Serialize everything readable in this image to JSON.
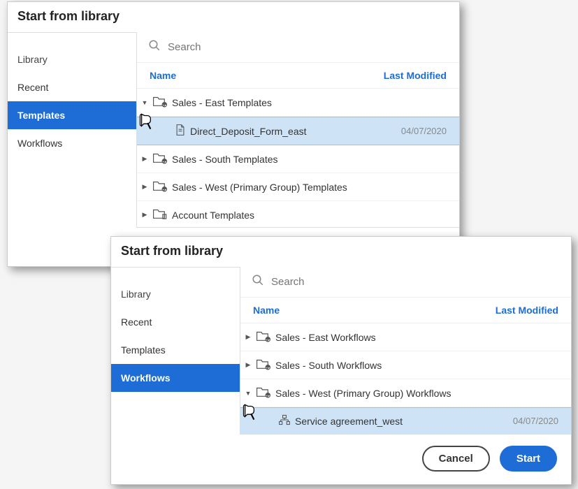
{
  "dialog1": {
    "title": "Start from library",
    "sidebar": {
      "heading": "Library",
      "items": [
        {
          "label": "Recent"
        },
        {
          "label": "Templates"
        },
        {
          "label": "Workflows"
        }
      ],
      "activeIndex": 1
    },
    "search": {
      "placeholder": "Search"
    },
    "columns": {
      "name": "Name",
      "modified": "Last Modified"
    },
    "tree": [
      {
        "label": "Sales - East Templates",
        "expanded": true,
        "iconType": "group"
      },
      {
        "label": "Direct_Deposit_Form_east",
        "date": "04/07/2020",
        "child": true,
        "selected": true,
        "iconType": "file"
      },
      {
        "label": "Sales - South Templates",
        "expanded": false,
        "iconType": "group"
      },
      {
        "label": "Sales - West (Primary Group) Templates",
        "expanded": false,
        "iconType": "group"
      },
      {
        "label": "Account Templates",
        "expanded": false,
        "iconType": "account"
      }
    ]
  },
  "dialog2": {
    "title": "Start from library",
    "sidebar": {
      "heading": "Library",
      "items": [
        {
          "label": "Recent"
        },
        {
          "label": "Templates"
        },
        {
          "label": "Workflows"
        }
      ],
      "activeIndex": 2
    },
    "search": {
      "placeholder": "Search"
    },
    "columns": {
      "name": "Name",
      "modified": "Last Modified"
    },
    "tree": [
      {
        "label": "Sales - East Workflows",
        "expanded": false,
        "iconType": "group"
      },
      {
        "label": "Sales - South Workflows",
        "expanded": false,
        "iconType": "group"
      },
      {
        "label": "Sales - West (Primary Group) Workflows",
        "expanded": true,
        "iconType": "group"
      },
      {
        "label": "Service agreement_west",
        "date": "04/07/2020",
        "child": true,
        "selected": true,
        "iconType": "flow"
      }
    ],
    "buttons": {
      "cancel": "Cancel",
      "start": "Start"
    }
  }
}
